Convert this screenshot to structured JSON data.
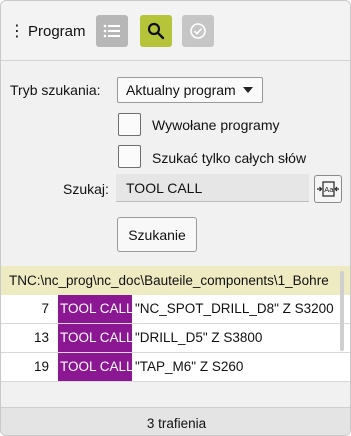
{
  "header": {
    "title": "Program",
    "menu_icon": "vertical-dots-icon",
    "buttons": [
      {
        "icon": "list-icon",
        "active": false
      },
      {
        "icon": "search-icon",
        "active": true
      },
      {
        "icon": "check-circle-icon",
        "active": false
      }
    ]
  },
  "search": {
    "mode_label": "Tryb szukania:",
    "mode_value": "Aktualny program",
    "option_called_programs": "Wywołane programy",
    "option_whole_words": "Szukać tylko całych słów",
    "query_label": "Szukaj:",
    "query_value": "TOOL CALL",
    "keyboard_icon": "keyboard-input-icon",
    "submit_label": "Szukanie"
  },
  "results": {
    "path": "TNC:\\nc_prog\\nc_doc\\Bauteile_components\\1_Bohre",
    "rows": [
      {
        "line": "7",
        "match": "TOOL CALL",
        "rest": "\"NC_SPOT_DRILL_D8\" Z S3200"
      },
      {
        "line": "13",
        "match": "TOOL CALL",
        "rest": "\"DRILL_D5\" Z S3800"
      },
      {
        "line": "19",
        "match": "TOOL CALL",
        "rest": "\"TAP_M6\" Z S260"
      }
    ],
    "summary": "3 trafienia"
  },
  "colors": {
    "accent": "#b6c43a",
    "highlight": "#8c1793",
    "path_bar": "#eeeac1"
  }
}
